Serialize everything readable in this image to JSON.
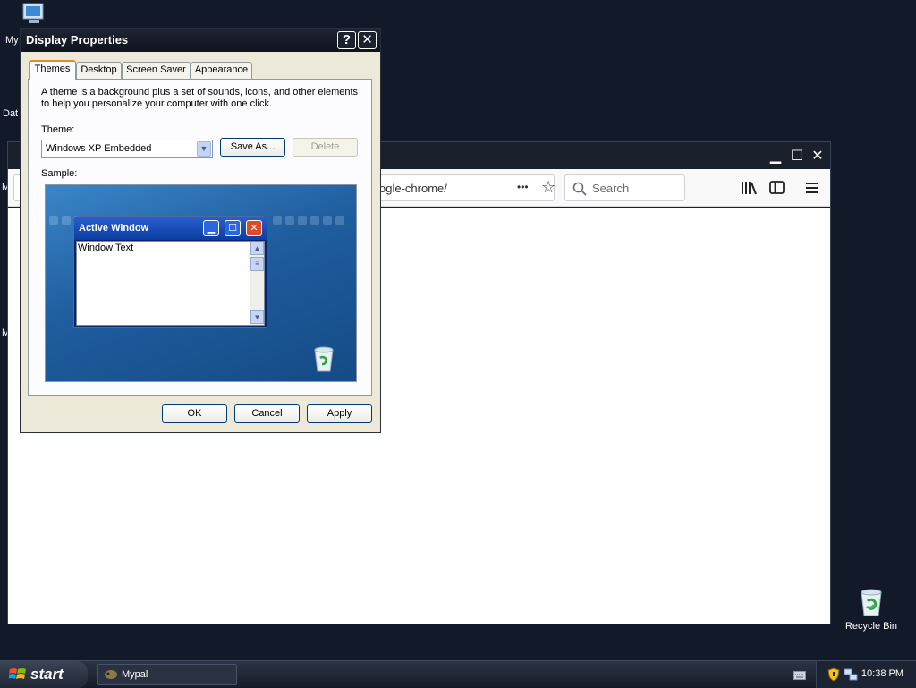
{
  "desktop": {
    "icon_my_computer_label": "My",
    "icon_data_label": "Dat",
    "icon_m1_label": "M",
    "icon_m2_label": "M",
    "recycle_bin_label": "Recycle Bin"
  },
  "browser": {
    "url_text": "ogle-chrome/",
    "search_placeholder": "Search",
    "more_glyph": "•••",
    "bookmark_glyph": "☆",
    "min_glyph": "▁",
    "max_glyph": "☐",
    "close_glyph": "✕"
  },
  "dialog": {
    "title": "Display Properties",
    "help_glyph": "?",
    "close_glyph": "✕",
    "tabs": [
      {
        "label": "Themes",
        "active": true
      },
      {
        "label": "Desktop",
        "active": false
      },
      {
        "label": "Screen Saver",
        "active": false
      },
      {
        "label": "Appearance",
        "active": false
      }
    ],
    "description": "A theme is a background plus a set of sounds, icons, and other elements to help you personalize your computer with one click.",
    "theme_label": "Theme:",
    "theme_value": "Windows XP Embedded",
    "save_as_label": "Save As...",
    "delete_label": "Delete",
    "sample_label": "Sample:",
    "sample_window": {
      "title": "Active Window",
      "body_text": "Window Text"
    },
    "buttons": {
      "ok": "OK",
      "cancel": "Cancel",
      "apply": "Apply"
    }
  },
  "taskbar": {
    "start_label": "start",
    "task_label": "Mypal",
    "clock": "10:38 PM"
  }
}
